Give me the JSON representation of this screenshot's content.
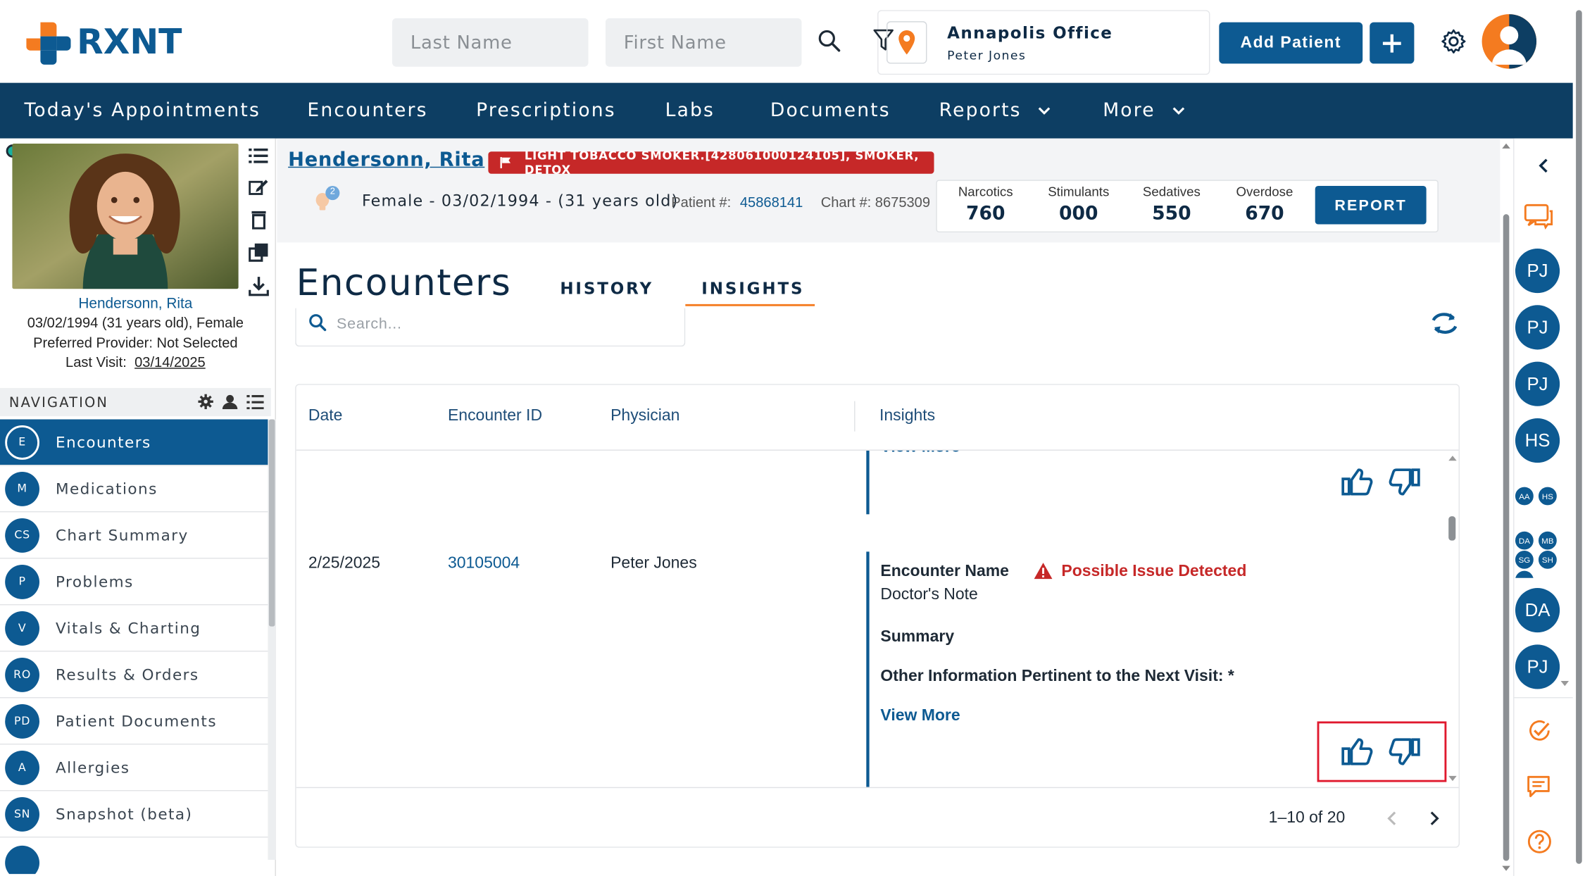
{
  "brand": {
    "logo_text": "RXNT",
    "primary": "#0d5a92",
    "nav_bg": "#0d3e63",
    "accent": "#f47b20",
    "alert": "#c62828"
  },
  "header": {
    "last_name_placeholder": "Last Name",
    "first_name_placeholder": "First Name",
    "office_name": "Annapolis Office",
    "office_user": "Peter Jones",
    "add_patient_label": "Add Patient",
    "icons": [
      "search-icon",
      "filter-icon",
      "location-pin-icon",
      "plus-icon",
      "gear-icon",
      "user-avatar-icon"
    ]
  },
  "nav": {
    "items": [
      {
        "label": "Today's Appointments"
      },
      {
        "label": "Encounters"
      },
      {
        "label": "Prescriptions"
      },
      {
        "label": "Labs"
      },
      {
        "label": "Documents"
      },
      {
        "label": "Reports",
        "dropdown": true
      },
      {
        "label": "More",
        "dropdown": true
      }
    ]
  },
  "patient_card": {
    "name": "Hendersonn, Rita",
    "dob_line": "03/02/1994 (31 years old), Female",
    "provider_line": "Preferred Provider: Not Selected",
    "last_visit_label": "Last Visit:",
    "last_visit_date": "03/14/2025"
  },
  "left_nav": {
    "title": "NAVIGATION",
    "items": [
      {
        "abbr": "E",
        "label": "Encounters",
        "active": true
      },
      {
        "abbr": "M",
        "label": "Medications"
      },
      {
        "abbr": "CS",
        "label": "Chart Summary"
      },
      {
        "abbr": "P",
        "label": "Problems"
      },
      {
        "abbr": "V",
        "label": "Vitals & Charting"
      },
      {
        "abbr": "RO",
        "label": "Results & Orders"
      },
      {
        "abbr": "PD",
        "label": "Patient Documents"
      },
      {
        "abbr": "A",
        "label": "Allergies"
      },
      {
        "abbr": "SN",
        "label": "Snapshot (beta)"
      }
    ]
  },
  "patient_bar": {
    "name": "Hendersonn, Rita",
    "flag": "LIGHT TOBACCO SMOKER.[428061000124105], SMOKER, DETOX",
    "badge_count": "2",
    "demographics": "Female - 03/02/1994 - (31 years old)",
    "patient_num_label": "Patient #:",
    "patient_num": "45868141",
    "chart_num": "Chart #: 8675309",
    "risks": [
      {
        "label": "Narcotics",
        "value": "760"
      },
      {
        "label": "Stimulants",
        "value": "000"
      },
      {
        "label": "Sedatives",
        "value": "550"
      },
      {
        "label": "Overdose",
        "value": "670"
      }
    ],
    "report_label": "REPORT"
  },
  "encounters": {
    "title": "Encounters",
    "tabs": [
      {
        "label": "HISTORY"
      },
      {
        "label": "INSIGHTS",
        "active": true
      }
    ],
    "search_placeholder": "Search...",
    "columns": [
      "Date",
      "Encounter ID",
      "Physician",
      "Insights"
    ],
    "prev_view_more": "View More",
    "row": {
      "date": "2/25/2025",
      "encounter_id": "30105004",
      "physician": "Peter Jones",
      "encounter_name_label": "Encounter Name",
      "issue": "Possible Issue Detected",
      "encounter_name": "Doctor's Note",
      "summary_label": "Summary",
      "other_info": "Other Information Pertinent to the Next Visit: *",
      "view_more": "View More"
    },
    "pagination": "1–10 of 20"
  },
  "right_bar": {
    "avatars": [
      "PJ",
      "PJ",
      "PJ",
      "HS"
    ],
    "small_avatars_1": [
      "AA",
      "HS"
    ],
    "small_avatars_2": [
      "DA",
      "MB",
      "SG",
      "SH"
    ],
    "avatars_bottom": [
      "DA",
      "PJ"
    ]
  }
}
